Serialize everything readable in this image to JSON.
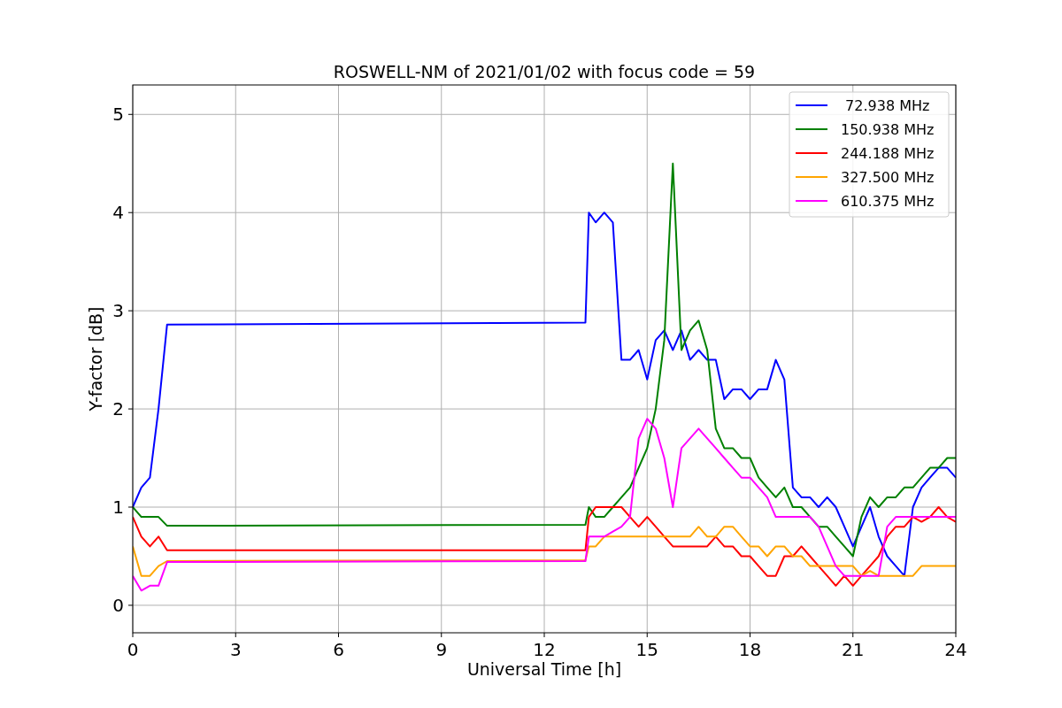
{
  "chart_data": {
    "type": "line",
    "title": "ROSWELL-NM of 2021/01/02 with focus code = 59",
    "xlabel": "Universal Time [h]",
    "ylabel": "Y-factor [dB]",
    "x": [
      0,
      0.25,
      0.5,
      0.75,
      1,
      13.2,
      13.3,
      13.5,
      13.75,
      14,
      14.25,
      14.5,
      14.75,
      15,
      15.25,
      15.5,
      15.75,
      16,
      16.25,
      16.5,
      16.75,
      17,
      17.25,
      17.5,
      17.75,
      18,
      18.25,
      18.5,
      18.75,
      19,
      19.25,
      19.5,
      19.75,
      20,
      20.25,
      20.5,
      20.75,
      21,
      21.25,
      21.5,
      21.75,
      22,
      22.25,
      22.5,
      22.75,
      23,
      23.25,
      23.5,
      23.75,
      24
    ],
    "series": [
      {
        "name": " 72.938 MHz",
        "color": "#0000ff",
        "values": [
          1.0,
          1.2,
          1.3,
          2.0,
          2.86,
          2.88,
          4.0,
          3.9,
          4.0,
          3.9,
          2.5,
          2.5,
          2.6,
          2.3,
          2.7,
          2.8,
          2.6,
          2.8,
          2.5,
          2.6,
          2.5,
          2.5,
          2.1,
          2.2,
          2.2,
          2.1,
          2.2,
          2.2,
          2.5,
          2.3,
          1.2,
          1.1,
          1.1,
          1.0,
          1.1,
          1.0,
          0.8,
          0.6,
          0.8,
          1.0,
          0.7,
          0.5,
          0.4,
          0.3,
          1.0,
          1.2,
          1.3,
          1.4,
          1.4,
          1.3
        ]
      },
      {
        "name": "150.938 MHz",
        "color": "#008000",
        "values": [
          1.0,
          0.9,
          0.9,
          0.9,
          0.81,
          0.82,
          1.0,
          0.9,
          0.9,
          1.0,
          1.1,
          1.2,
          1.4,
          1.6,
          2.0,
          2.7,
          4.5,
          2.6,
          2.8,
          2.9,
          2.6,
          1.8,
          1.6,
          1.6,
          1.5,
          1.5,
          1.3,
          1.2,
          1.1,
          1.2,
          1.0,
          1.0,
          0.9,
          0.8,
          0.8,
          0.7,
          0.6,
          0.5,
          0.9,
          1.1,
          1.0,
          1.1,
          1.1,
          1.2,
          1.2,
          1.3,
          1.4,
          1.4,
          1.5,
          1.5
        ]
      },
      {
        "name": "244.188 MHz",
        "color": "#ff0000",
        "values": [
          0.9,
          0.7,
          0.6,
          0.7,
          0.56,
          0.56,
          0.9,
          1.0,
          1.0,
          1.0,
          1.0,
          0.9,
          0.8,
          0.9,
          0.8,
          0.7,
          0.6,
          0.6,
          0.6,
          0.6,
          0.6,
          0.7,
          0.6,
          0.6,
          0.5,
          0.5,
          0.4,
          0.3,
          0.3,
          0.5,
          0.5,
          0.6,
          0.5,
          0.4,
          0.3,
          0.2,
          0.3,
          0.2,
          0.3,
          0.4,
          0.5,
          0.7,
          0.8,
          0.8,
          0.9,
          0.85,
          0.9,
          1.0,
          0.9,
          0.85
        ]
      },
      {
        "name": "327.500 MHz",
        "color": "#ffa500",
        "values": [
          0.6,
          0.3,
          0.3,
          0.4,
          0.45,
          0.46,
          0.6,
          0.6,
          0.7,
          0.7,
          0.7,
          0.7,
          0.7,
          0.7,
          0.7,
          0.7,
          0.7,
          0.7,
          0.7,
          0.8,
          0.7,
          0.7,
          0.8,
          0.8,
          0.7,
          0.6,
          0.6,
          0.5,
          0.6,
          0.6,
          0.5,
          0.5,
          0.4,
          0.4,
          0.4,
          0.4,
          0.4,
          0.4,
          0.3,
          0.35,
          0.3,
          0.3,
          0.3,
          0.3,
          0.3,
          0.4,
          0.4,
          0.4,
          0.4,
          0.4
        ]
      },
      {
        "name": "610.375 MHz",
        "color": "#ff00ff",
        "values": [
          0.3,
          0.15,
          0.2,
          0.2,
          0.44,
          0.45,
          0.7,
          0.7,
          0.7,
          0.75,
          0.8,
          0.9,
          1.7,
          1.9,
          1.8,
          1.5,
          1.0,
          1.6,
          1.7,
          1.8,
          1.7,
          1.6,
          1.5,
          1.4,
          1.3,
          1.3,
          1.2,
          1.1,
          0.9,
          0.9,
          0.9,
          0.9,
          0.9,
          0.8,
          0.6,
          0.4,
          0.3,
          0.3,
          0.3,
          0.3,
          0.3,
          0.8,
          0.9,
          0.9,
          0.9,
          0.9,
          0.9,
          0.9,
          0.9,
          0.9
        ]
      }
    ],
    "grid": true,
    "legend": true,
    "xlim": [
      0,
      24
    ],
    "ylim": [
      -0.28,
      5.3
    ],
    "xticks": [
      0,
      3,
      6,
      9,
      12,
      15,
      18,
      21,
      24
    ],
    "yticks": [
      0,
      1,
      2,
      3,
      4,
      5
    ]
  }
}
